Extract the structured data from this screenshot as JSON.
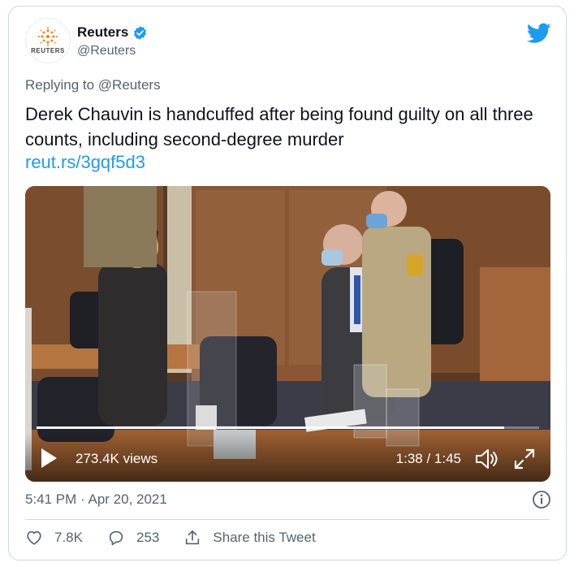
{
  "author": {
    "name": "Reuters",
    "handle": "@Reuters",
    "avatar_text": "REUTERS",
    "verified_color": "#1d9bf0"
  },
  "brand_icon": "twitter-bird-icon",
  "reply": {
    "prefix": "Replying to ",
    "mention": "@Reuters"
  },
  "tweet": {
    "text": "Derek Chauvin is handcuffed after being found guilty on all three counts, including second-degree murder",
    "link": "reut.rs/3gqf5d3"
  },
  "video": {
    "views": "273.4K views",
    "time": "1:38 / 1:45",
    "progress_fraction": 0.93
  },
  "meta": {
    "timestamp": "5:41 PM · Apr 20, 2021"
  },
  "actions": {
    "likes": "7.8K",
    "replies": "253",
    "share_label": "Share this Tweet"
  },
  "colors": {
    "accent": "#1d9bf0",
    "secondary_text": "#536471",
    "border": "#cfd9de"
  }
}
